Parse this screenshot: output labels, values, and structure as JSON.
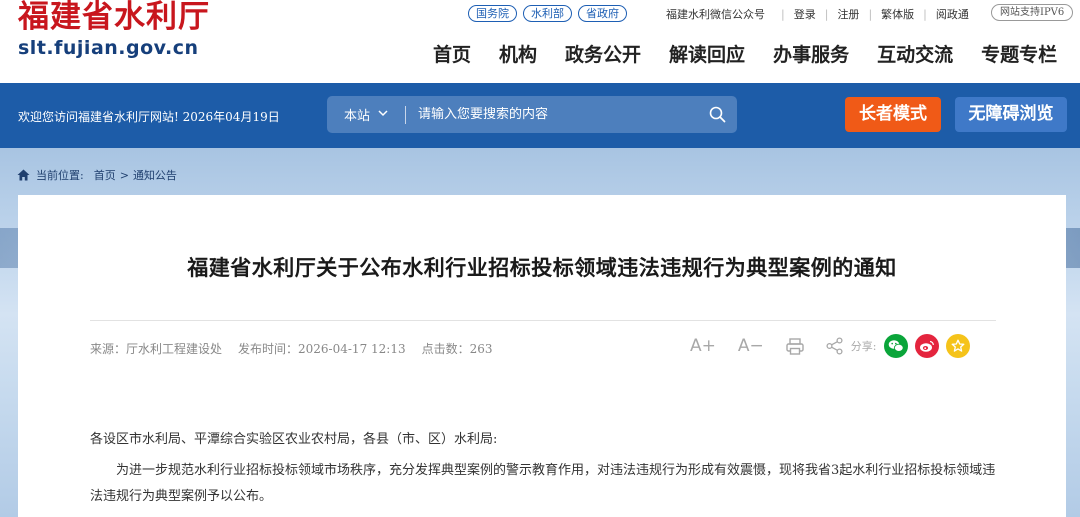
{
  "header": {
    "logo_cn": "福建省水利厅",
    "logo_url": "slt.fujian.gov.cn",
    "gov_links": [
      "国务院",
      "水利部",
      "省政府"
    ],
    "utils": [
      "福建水利微信公众号",
      "登录",
      "注册",
      "繁体版",
      "阅政通"
    ],
    "ipv6": "网站支持IPV6",
    "nav": [
      "首页",
      "机构",
      "政务公开",
      "解读回应",
      "办事服务",
      "互动交流",
      "专题专栏"
    ]
  },
  "bluebar": {
    "welcome": "欢迎您访问福建省水利厅网站! 2026年04月19日",
    "search_scope": "本站",
    "search_placeholder": "请输入您要搜索的内容",
    "elder_mode": "长者模式",
    "accessible": "无障碍浏览"
  },
  "breadcrumb": {
    "label": "当前位置:",
    "home": "首页",
    "sep": ">",
    "current": "通知公告"
  },
  "article": {
    "title": "福建省水利厅关于公布水利行业招标投标领域违法违规行为典型案例的通知",
    "source": "来源：厅水利工程建设处",
    "publish_time": "发布时间：2026-04-17 12:13",
    "clicks": "点击数：263",
    "tools": {
      "font_up": "A+",
      "font_down": "A−",
      "share_label": "分享:"
    },
    "salutation": "各设区市水利局、平潭综合实验区农业农村局，各县（市、区）水利局:",
    "paragraph1": "为进一步规范水利行业招标投标领域市场秩序，充分发挥典型案例的警示教育作用，对违法违规行为形成有效震慑，现将我省3起水利行业招标投标领域违法违规行为典型案例予以公布。"
  },
  "colors": {
    "brand_red": "#c8161d",
    "brand_blue": "#1d5ca8",
    "elder_orange": "#f05a17",
    "wechat_green": "#0aa53a",
    "weibo_red": "#e4253e",
    "fav_yellow": "#f5c31a"
  }
}
